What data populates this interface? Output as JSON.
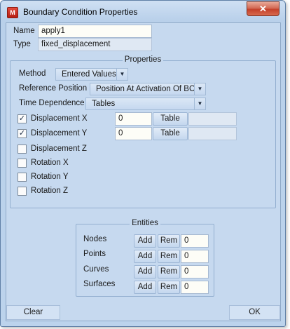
{
  "window": {
    "icon_letter": "M",
    "title": "Boundary Condition Properties",
    "close_glyph": "✕"
  },
  "header": {
    "name_label": "Name",
    "name_value": "apply1",
    "type_label": "Type",
    "type_value": "fixed_displacement"
  },
  "properties": {
    "title": "Properties",
    "method_label": "Method",
    "method_value": "Entered Values",
    "reference_label": "Reference Position",
    "reference_value": "Position At Activation Of BC",
    "time_label": "Time Dependence",
    "time_value": "Tables",
    "dofs": [
      {
        "label": "Displacement X",
        "checked": true,
        "value": "0",
        "table_label": "Table",
        "table_value": ""
      },
      {
        "label": "Displacement Y",
        "checked": true,
        "value": "0",
        "table_label": "Table",
        "table_value": ""
      },
      {
        "label": "Displacement Z",
        "checked": false
      },
      {
        "label": "Rotation X",
        "checked": false
      },
      {
        "label": "Rotation Y",
        "checked": false
      },
      {
        "label": "Rotation Z",
        "checked": false
      }
    ]
  },
  "entities": {
    "title": "Entities",
    "add_label": "Add",
    "rem_label": "Rem",
    "rows": [
      {
        "label": "Nodes",
        "count": "0"
      },
      {
        "label": "Points",
        "count": "0"
      },
      {
        "label": "Curves",
        "count": "0"
      },
      {
        "label": "Surfaces",
        "count": "0"
      }
    ]
  },
  "footer": {
    "clear_label": "Clear",
    "ok_label": "OK"
  },
  "icons": {
    "check": "✓",
    "dropdown": "▼"
  }
}
